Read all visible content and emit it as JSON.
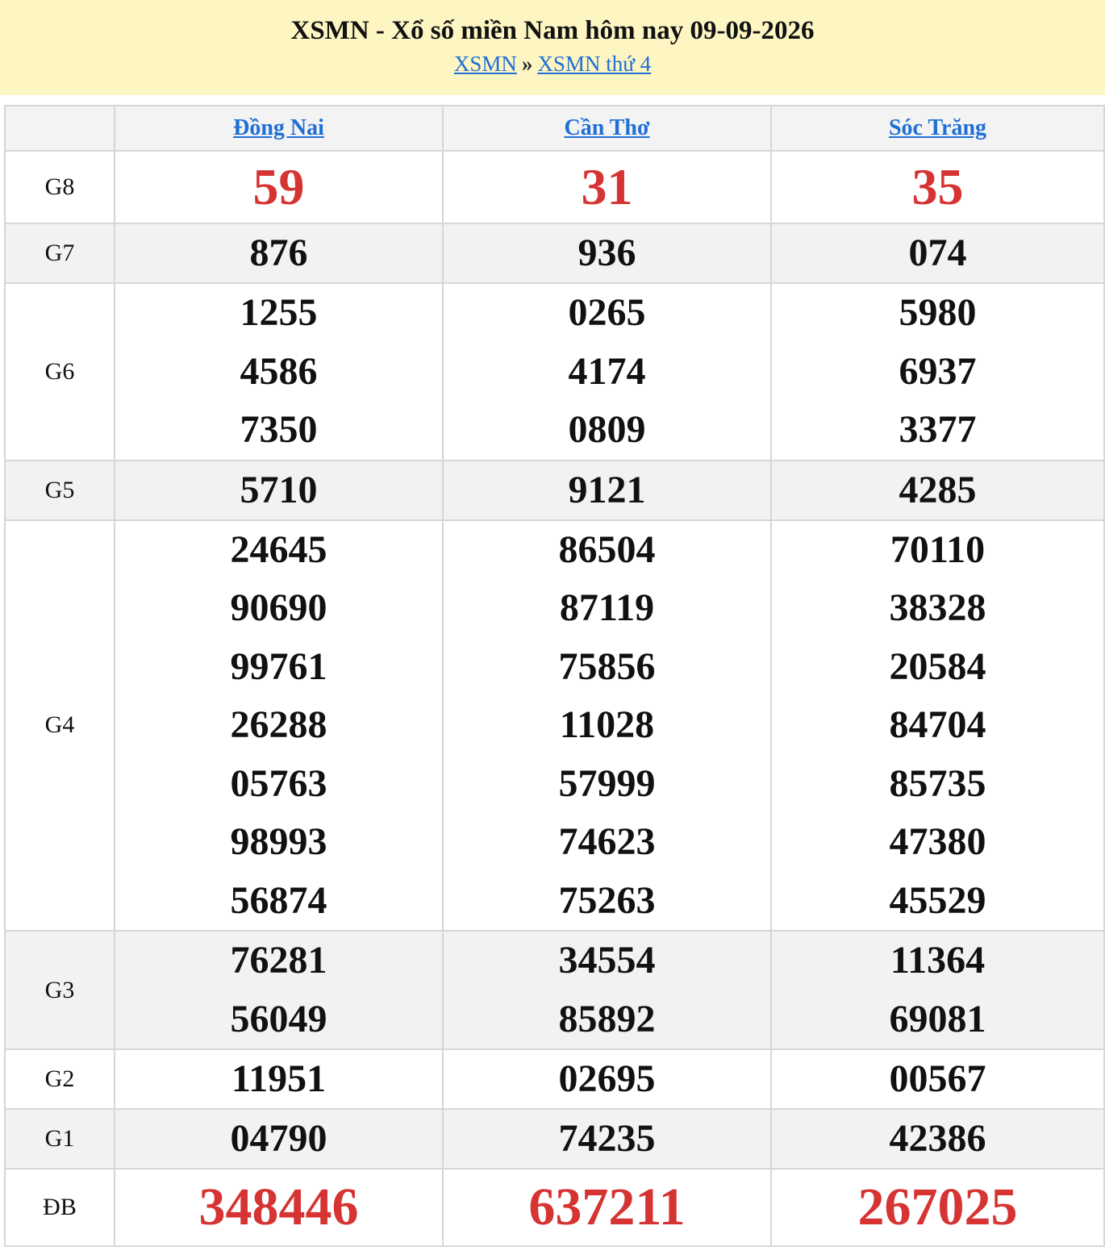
{
  "header": {
    "title": "XSMN - Xổ số miền Nam hôm nay 09-09-2026",
    "breadcrumb": {
      "link1": "XSMN",
      "separator": "»",
      "link2": "XSMN thứ 4"
    }
  },
  "colors": {
    "header_bg": "#fdf5c2",
    "link": "#1f6fd6",
    "highlight": "#d63333",
    "row_alt": "#f2f2f2",
    "border": "#d6d6d6"
  },
  "provinces": [
    "Đồng Nai",
    "Cần Thơ",
    "Sóc Trăng"
  ],
  "prizes": [
    {
      "label": "G8",
      "key": "g8",
      "alt": false,
      "values": [
        [
          "59"
        ],
        [
          "31"
        ],
        [
          "35"
        ]
      ]
    },
    {
      "label": "G7",
      "key": "g7",
      "alt": true,
      "values": [
        [
          "876"
        ],
        [
          "936"
        ],
        [
          "074"
        ]
      ]
    },
    {
      "label": "G6",
      "key": "g6",
      "alt": false,
      "values": [
        [
          "1255",
          "4586",
          "7350"
        ],
        [
          "0265",
          "4174",
          "0809"
        ],
        [
          "5980",
          "6937",
          "3377"
        ]
      ]
    },
    {
      "label": "G5",
      "key": "g5",
      "alt": true,
      "values": [
        [
          "5710"
        ],
        [
          "9121"
        ],
        [
          "4285"
        ]
      ]
    },
    {
      "label": "G4",
      "key": "g4",
      "alt": false,
      "values": [
        [
          "24645",
          "90690",
          "99761",
          "26288",
          "05763",
          "98993",
          "56874"
        ],
        [
          "86504",
          "87119",
          "75856",
          "11028",
          "57999",
          "74623",
          "75263"
        ],
        [
          "70110",
          "38328",
          "20584",
          "84704",
          "85735",
          "47380",
          "45529"
        ]
      ]
    },
    {
      "label": "G3",
      "key": "g3",
      "alt": true,
      "values": [
        [
          "76281",
          "56049"
        ],
        [
          "34554",
          "85892"
        ],
        [
          "11364",
          "69081"
        ]
      ]
    },
    {
      "label": "G2",
      "key": "g2",
      "alt": false,
      "values": [
        [
          "11951"
        ],
        [
          "02695"
        ],
        [
          "00567"
        ]
      ]
    },
    {
      "label": "G1",
      "key": "g1",
      "alt": true,
      "values": [
        [
          "04790"
        ],
        [
          "74235"
        ],
        [
          "42386"
        ]
      ]
    },
    {
      "label": "ĐB",
      "key": "gdb",
      "alt": false,
      "values": [
        [
          "348446"
        ],
        [
          "637211"
        ],
        [
          "267025"
        ]
      ]
    }
  ]
}
